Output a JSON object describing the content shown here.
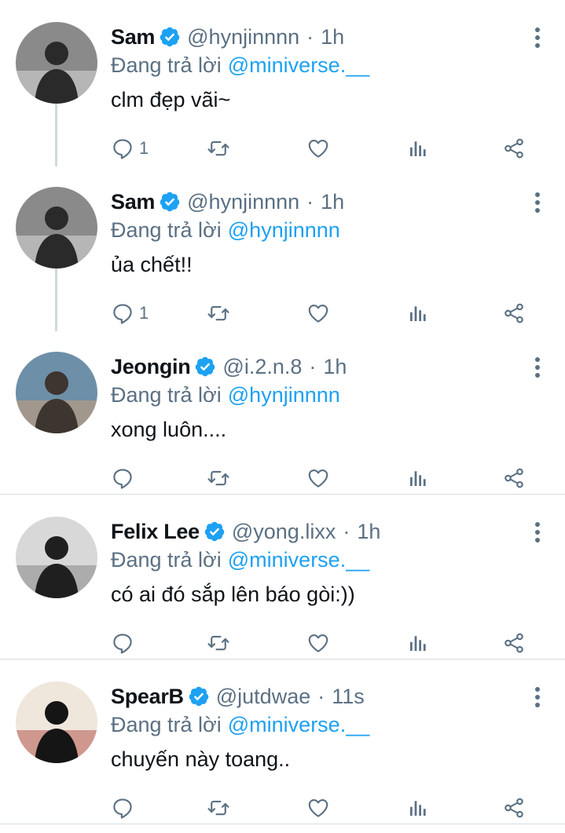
{
  "tweets": [
    {
      "name": "Sam",
      "handle": "@hynjinnnn",
      "time": "1h",
      "reply_label": "Đang trả lời",
      "reply_to": "@miniverse.__",
      "text": "clm đẹp vãi~",
      "reply_count": "1",
      "avatar_colors": [
        "#8a8a8a",
        "#2a2a2a",
        "#c9c9c9"
      ]
    },
    {
      "name": "Sam",
      "handle": "@hynjinnnn",
      "time": "1h",
      "reply_label": "Đang trả lời",
      "reply_to": "@hynjinnnn",
      "text": "ủa chết!!",
      "reply_count": "1",
      "avatar_colors": [
        "#8a8a8a",
        "#2a2a2a",
        "#c9c9c9"
      ]
    },
    {
      "name": "Jeongin",
      "handle": "@i.2.n.8",
      "time": "1h",
      "reply_label": "Đang trả lời",
      "reply_to": "@hynjinnnn",
      "text": "xong luôn....",
      "reply_count": "",
      "avatar_colors": [
        "#6e8fa8",
        "#3d3530",
        "#b89a80"
      ]
    },
    {
      "name": "Felix Lee",
      "handle": "@yong.lixx",
      "time": "1h",
      "reply_label": "Đang trả lời",
      "reply_to": "@miniverse.__",
      "text": "có ai đó sắp lên báo gòi:))",
      "reply_count": "",
      "avatar_colors": [
        "#d8d8d8",
        "#1f1f1f",
        "#9a9a9a"
      ]
    },
    {
      "name": "SpearB",
      "handle": "@jutdwae",
      "time": "11s",
      "reply_label": "Đang trả lời",
      "reply_to": "@miniverse.__",
      "text": "chuyến này toang..",
      "reply_count": "",
      "avatar_colors": [
        "#efe6dc",
        "#151515",
        "#c0766e"
      ]
    }
  ],
  "icons": {
    "verified": "verified-badge-icon",
    "more": "more-vertical-icon",
    "reply": "reply-icon",
    "retweet": "retweet-icon",
    "like": "like-icon",
    "analytics": "analytics-icon",
    "share": "share-icon"
  },
  "colors": {
    "accent": "#1da1f2",
    "muted": "#5b7083",
    "divider": "#d6dbe0",
    "thread": "#cfd9de"
  }
}
